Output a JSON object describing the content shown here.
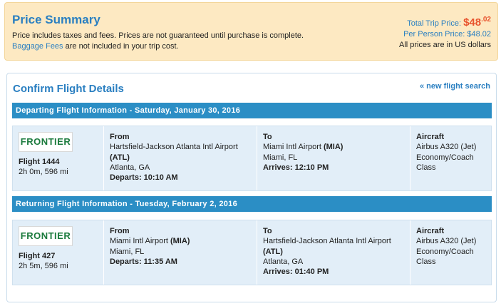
{
  "summary": {
    "title": "Price Summary",
    "line1": "Price includes taxes and fees. Prices are not guaranteed until purchase is complete.",
    "baggage_link": "Baggage Fees",
    "line2_rest": " are not included in your trip cost.",
    "total_label": "Total Trip Price: ",
    "total_dollars": "$48",
    "total_cents": ".02",
    "per_person": "Per Person Price: $48.02",
    "currency_note": "All prices are in US dollars"
  },
  "confirm": {
    "title": "Confirm Flight Details",
    "new_search": "« new flight search"
  },
  "flights": [
    {
      "header": "Departing Flight Information - Saturday, January 30, 2016",
      "airline_logo": "FRONTIER",
      "flight": "Flight 1444",
      "duration": "2h 0m, 596 mi",
      "from_label": "From",
      "from_airport": "Hartsfield-Jackson Atlanta Intl Airport",
      "from_code": "(ATL)",
      "from_city": "Atlanta, GA",
      "departs": "Departs: 10:10 AM",
      "to_label": "To",
      "to_airport": "Miami Intl Airport",
      "to_code": "(MIA)",
      "to_city": "Miami, FL",
      "arrives": "Arrives: 12:10 PM",
      "aircraft_label": "Aircraft",
      "aircraft": "Airbus A320 (Jet)",
      "cabin": "Economy/Coach",
      "cabin2": "Class"
    },
    {
      "header": "Returning Flight Information - Tuesday, February 2, 2016",
      "airline_logo": "FRONTIER",
      "flight": "Flight 427",
      "duration": "2h 5m, 596 mi",
      "from_label": "From",
      "from_airport": "Miami Intl Airport",
      "from_code": "(MIA)",
      "from_city": "Miami, FL",
      "departs": "Departs: 11:35 AM",
      "to_label": "To",
      "to_airport": "Hartsfield-Jackson Atlanta Intl Airport",
      "to_code": "(ATL)",
      "to_city": "Atlanta, GA",
      "arrives": "Arrives: 01:40 PM",
      "aircraft_label": "Aircraft",
      "aircraft": "Airbus A320 (Jet)",
      "cabin": "Economy/Coach",
      "cabin2": "Class"
    }
  ],
  "colors": {
    "accent": "#2a7fc1",
    "bar": "#2b8ec5",
    "price": "#e8542e",
    "summary_bg": "#fde9c2",
    "airline_green": "#1a7a3c"
  }
}
